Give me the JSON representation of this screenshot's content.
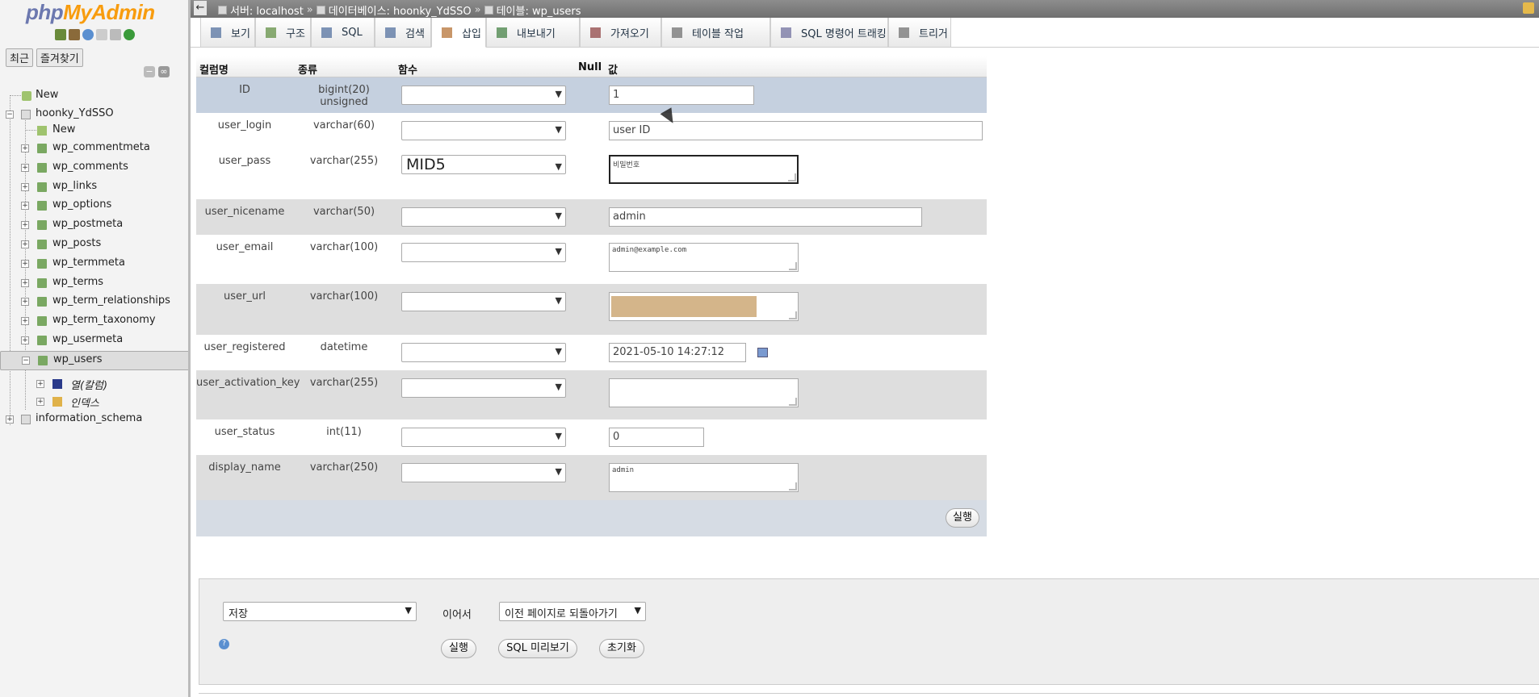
{
  "nav": {
    "logo_a": "php",
    "logo_b": "MyAdmin",
    "tabs": [
      "최근",
      "즐겨찾기"
    ],
    "tree": {
      "new_root": "New",
      "db": "hoonky_YdSSO",
      "db_new": "New",
      "tables": [
        "wp_commentmeta",
        "wp_comments",
        "wp_links",
        "wp_options",
        "wp_postmeta",
        "wp_posts",
        "wp_termmeta",
        "wp_terms",
        "wp_term_relationships",
        "wp_term_taxonomy",
        "wp_usermeta",
        "wp_users"
      ],
      "sub_columns": "열(칼럼)",
      "sub_index": "인덱스",
      "info_schema": "information_schema"
    }
  },
  "breadcrumb": {
    "server": "서버: localhost",
    "database": "데이터베이스: hoonky_YdSSO",
    "table": "테이블: wp_users",
    "sep": "»"
  },
  "tabs": [
    "보기",
    "구조",
    "SQL",
    "검색",
    "삽입",
    "내보내기",
    "가져오기",
    "테이블 작업",
    "SQL 명령어 트래킹",
    "트리거"
  ],
  "active_tab": "삽입",
  "insert": {
    "headers": {
      "column": "컬럼명",
      "type": "종류",
      "function": "함수",
      "null": "Null",
      "value": "값"
    },
    "rows": [
      {
        "name": "ID",
        "type": "bigint(20) unsigned",
        "function": "",
        "value": "1"
      },
      {
        "name": "user_login",
        "type": "varchar(60)",
        "function": "",
        "value": "user ID"
      },
      {
        "name": "user_pass",
        "type": "varchar(255)",
        "function": "MID5",
        "value": "비밀번호"
      },
      {
        "name": "user_nicename",
        "type": "varchar(50)",
        "function": "",
        "value": "admin"
      },
      {
        "name": "user_email",
        "type": "varchar(100)",
        "function": "",
        "value": "admin@example.com"
      },
      {
        "name": "user_url",
        "type": "varchar(100)",
        "function": "",
        "value": ""
      },
      {
        "name": "user_registered",
        "type": "datetime",
        "function": "",
        "value": "2021-05-10 14:27:12"
      },
      {
        "name": "user_activation_key",
        "type": "varchar(255)",
        "function": "",
        "value": ""
      },
      {
        "name": "user_status",
        "type": "int(11)",
        "function": "",
        "value": "0"
      },
      {
        "name": "display_name",
        "type": "varchar(250)",
        "function": "",
        "value": "admin"
      }
    ],
    "submit": "실행"
  },
  "bottom": {
    "action_select": "저장",
    "then_label": "이어서",
    "then_select": "이전 페이지로 되돌아가기",
    "go": "실행",
    "preview": "SQL 미리보기",
    "reset": "초기화",
    "help": "?"
  },
  "colors": {
    "logo_blue": "#6c78af",
    "logo_orange": "#f89c0e",
    "first_row": "#c5d0df",
    "alt_row": "#dedede",
    "redacted": "#d4b58a"
  }
}
